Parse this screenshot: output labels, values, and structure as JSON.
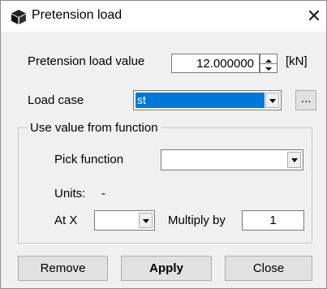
{
  "window": {
    "title": "Pretension load",
    "icon": "cube-icon",
    "close_label": "✕"
  },
  "pretension": {
    "label": "Pretension load value",
    "value": "12.000000",
    "unit": "[kN]"
  },
  "load_case": {
    "label": "Load case",
    "selected": "st",
    "browse_label": "...",
    "selected_bg": "#0078d7"
  },
  "function_group": {
    "title": "Use value from function",
    "pick_label": "Pick function",
    "pick_selected": "",
    "units_label": "Units:",
    "units_value": "-",
    "at_x_label": "At X",
    "at_x_selected": "",
    "multiply_label": "Multiply by",
    "multiply_value": "1"
  },
  "buttons": {
    "remove": "Remove",
    "apply": "Apply",
    "close": "Close"
  }
}
